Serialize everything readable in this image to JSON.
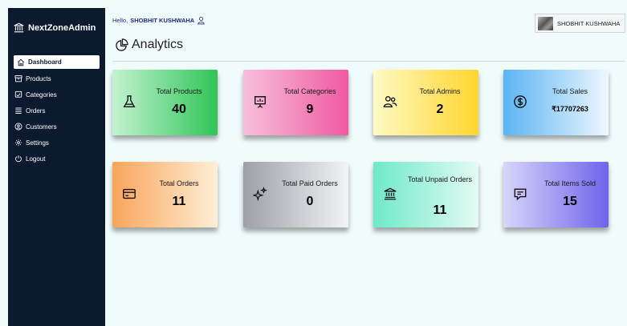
{
  "sidebar": {
    "brand": "NextZoneAdmin",
    "brand_icon": "bank-icon",
    "items": [
      {
        "label": "Dashboard",
        "icon": "home-icon",
        "active": true
      },
      {
        "label": "Products",
        "icon": "box-icon"
      },
      {
        "label": "Categories",
        "icon": "cart-icon"
      },
      {
        "label": "Orders",
        "icon": "list-icon"
      },
      {
        "label": "Customers",
        "icon": "user-circle-icon"
      },
      {
        "label": "Settings",
        "icon": "gear-icon"
      },
      {
        "label": "Logout",
        "icon": "power-icon"
      }
    ]
  },
  "header": {
    "greeting": "Hello,",
    "username": "SHOBHIT KUSHWAHA",
    "user_button_label": "SHOBHIT KUSHWAHA"
  },
  "page": {
    "title": "Analytics",
    "title_icon": "pie-chart-icon"
  },
  "cards": [
    {
      "label": "Total Products",
      "value": "40",
      "icon": "flask-icon"
    },
    {
      "label": "Total Categories",
      "value": "9",
      "icon": "presentation-icon"
    },
    {
      "label": "Total Admins",
      "value": "2",
      "icon": "users-icon"
    },
    {
      "label": "Total Sales",
      "value": "₹17707263",
      "icon": "dollar-circle-icon"
    },
    {
      "label": "Total Orders",
      "value": "11",
      "icon": "credit-card-icon"
    },
    {
      "label": "Total Paid Orders",
      "value": "0",
      "icon": "sparkles-icon"
    },
    {
      "label": "Total Unpaid Orders",
      "value": "11",
      "icon": "bank-icon"
    },
    {
      "label": "Total Items Sold",
      "value": "15",
      "icon": "message-icon"
    }
  ],
  "colors": {
    "sidebar_bg": "#0b1a2e",
    "page_bg": "#f0fbfb",
    "greeting_text": "#1e2a8a"
  }
}
